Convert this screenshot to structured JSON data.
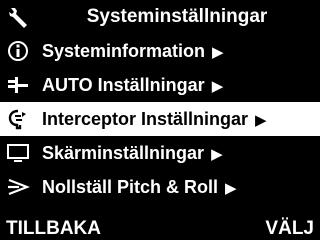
{
  "header": {
    "title": "Systeminställningar",
    "icon": "wrench-icon"
  },
  "menu": {
    "selected_index": 2,
    "items": [
      {
        "label": "Systeminformation",
        "icon": "info-icon",
        "arrow": "▶"
      },
      {
        "label": "AUTO Inställningar",
        "icon": "helm-icon",
        "arrow": "▶"
      },
      {
        "label": "Interceptor Inställningar",
        "icon": "interceptor-icon",
        "arrow": "▶"
      },
      {
        "label": "Skärminställningar",
        "icon": "display-icon",
        "arrow": "▶"
      },
      {
        "label": "Nollställ Pitch & Roll",
        "icon": "pitch-roll-icon",
        "arrow": "▶"
      }
    ]
  },
  "footer": {
    "back_label": "TILLBAKA",
    "select_label": "VÄLJ"
  },
  "colors": {
    "background": "#000000",
    "text": "#ffffff",
    "highlight_bg": "#ffffff",
    "highlight_text": "#000000"
  }
}
